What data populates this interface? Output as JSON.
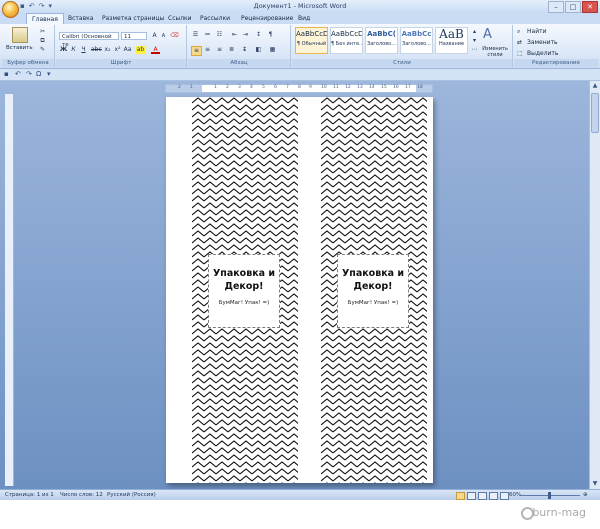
{
  "window": {
    "title": "Документ1 - Microsoft Word"
  },
  "quick_access": {
    "save_icon": "save-icon",
    "undo_icon": "undo-icon",
    "redo_icon": "redo-icon"
  },
  "tabs": [
    {
      "label": "Главная",
      "active": true
    },
    {
      "label": "Вставка"
    },
    {
      "label": "Разметка страницы"
    },
    {
      "label": "Ссылки"
    },
    {
      "label": "Рассылки"
    },
    {
      "label": "Рецензирование"
    },
    {
      "label": "Вид"
    }
  ],
  "ribbon": {
    "clipboard": {
      "paste_label": "Вставить",
      "group_label": "Буфер обмена"
    },
    "font": {
      "font_name": "Calibri (Основной те",
      "font_size": "11",
      "group_label": "Шрифт"
    },
    "paragraph": {
      "group_label": "Абзац"
    },
    "styles": {
      "group_label": "Стили",
      "tiles": [
        {
          "sample": "AaBbCcDc",
          "name": "¶ Обычный"
        },
        {
          "sample": "AaBbCcDc",
          "name": "¶ Без инте..."
        },
        {
          "sample": "AaBbC(",
          "name": "Заголово..."
        },
        {
          "sample": "AaBbCc",
          "name": "Заголово..."
        },
        {
          "sample": "AaB",
          "name": "Название"
        }
      ],
      "change_styles_label": "Изменить стили"
    },
    "editing": {
      "group_label": "Редактирование",
      "find_label": "Найти",
      "replace_label": "Заменить",
      "select_label": "Выделить"
    }
  },
  "ruler": {
    "numbers": [
      "2",
      "1",
      "1",
      "2",
      "3",
      "4",
      "5",
      "6",
      "7",
      "8",
      "9",
      "10",
      "11",
      "12",
      "13",
      "14",
      "15",
      "16",
      "17",
      "18"
    ]
  },
  "document": {
    "cards": [
      {
        "title": "Упаковка и Декор!",
        "subtitle": "БумМаг! Упак! =)"
      },
      {
        "title": "Упаковка и Декор!",
        "subtitle": "БумМаг! Упак! =)"
      }
    ]
  },
  "status": {
    "page": "Страница: 1 из 1",
    "words": "Число слов: 12",
    "language": "Русский (Россия)",
    "zoom": "60%"
  },
  "watermark": {
    "text": "burn-mag"
  }
}
